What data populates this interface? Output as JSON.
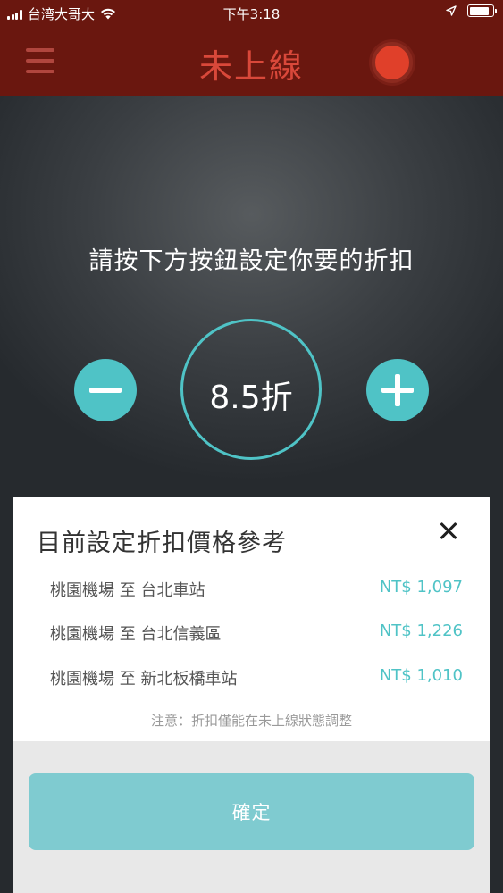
{
  "status_bar": {
    "carrier": "台湾大哥大",
    "time": "下午3:18",
    "battery_level": 0.85
  },
  "header": {
    "title": "未上線"
  },
  "main": {
    "instruction": "請按下方按鈕設定你要的折扣",
    "discount_value": "8.5折"
  },
  "sheet": {
    "title": "目前設定折扣價格參考",
    "routes": [
      {
        "name": "桃園機場 至 台北車站",
        "price": "NT$ 1,097"
      },
      {
        "name": "桃園機場 至 台北信義區",
        "price": "NT$ 1,226"
      },
      {
        "name": "桃園機場 至 新北板橋車站",
        "price": "NT$ 1,010"
      }
    ],
    "note": "注意：折扣僅能在未上線狀態調整"
  },
  "footer": {
    "confirm_label": "確定"
  },
  "colors": {
    "header_bg": "#6a170f",
    "title_red": "#d9483a",
    "accent_teal": "#4fc3c6",
    "confirm_teal": "#7fcbd0",
    "status_dot": "#e0402a"
  },
  "icons": [
    "signal-icon",
    "wifi-icon",
    "location-arrow-icon",
    "battery-icon",
    "menu-icon",
    "status-dot-icon",
    "minus-icon",
    "plus-icon",
    "close-icon"
  ]
}
